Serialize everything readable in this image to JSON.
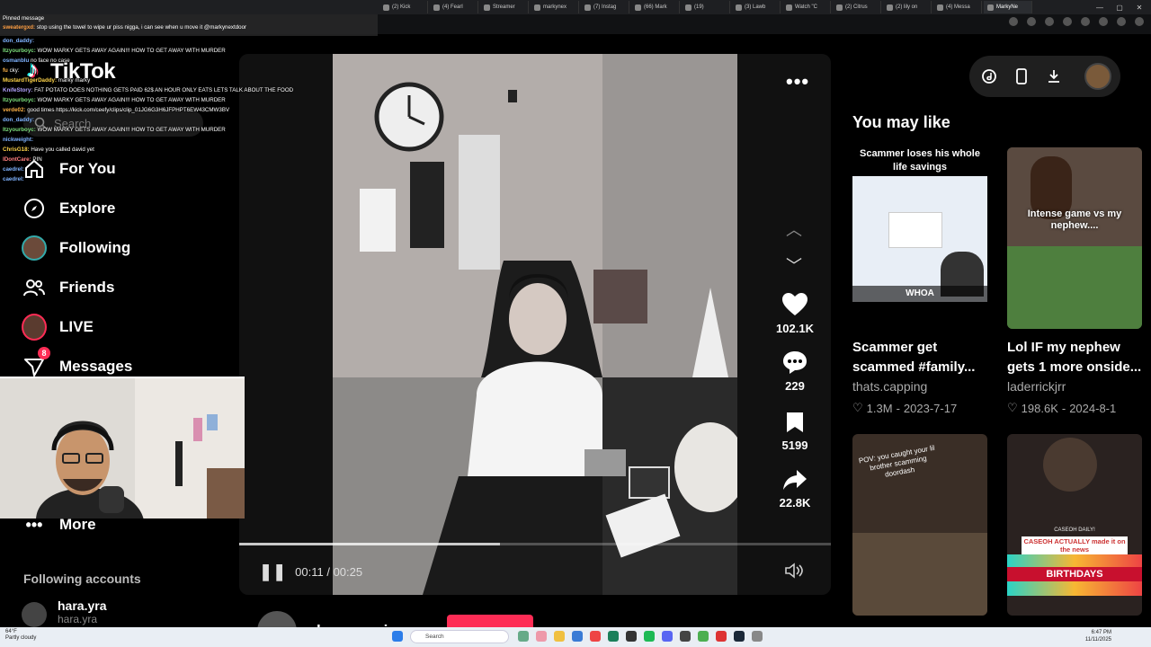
{
  "browser": {
    "tabs": [
      "(2) Kick",
      "(4) Fearl",
      "Streamer",
      "markynex",
      "(7) Instag",
      "(66) Mark",
      "(19)",
      "(3) Lawb",
      "Watch \"C",
      "(2) Citrus",
      "(2) lily on",
      "(4) Messa",
      "MarkyNe"
    ]
  },
  "chat": {
    "pinned_label": "Pinned message",
    "pinned_user": "sweatergxd:",
    "pinned_text": "stop using the towel to wipe ur piss nigga, i can see when u move it @markynextdoor",
    "lines": [
      {
        "user": "don_daddy:",
        "color": "#7fb3ff",
        "text": ""
      },
      {
        "user": "Itzyourboyc:",
        "color": "#7de07d",
        "text": "WOW MARKY GETS AWAY AGAIN!!! HOW TO GET AWAY WITH MURDER"
      },
      {
        "user": "osmanblu",
        "color": "#7fb3ff",
        "text": "no face no case"
      },
      {
        "user": "fu",
        "color": "#ffb347",
        "text": "cky:"
      },
      {
        "user": "MustardTigerDaddy:",
        "color": "#ffd54a",
        "text": "marky marky"
      },
      {
        "user": "KnifeStory:",
        "color": "#b3a3ff",
        "text": "FAT POTATO DOES NOTHING GETS PAID 62$ AN HOUR ONLY EATS LETS TALK ABOUT THE FOOD"
      },
      {
        "user": "Itzyourboyc:",
        "color": "#7de07d",
        "text": "WOW MARKY GETS AWAY AGAIN!!! HOW TO GET AWAY WITH MURDER"
      },
      {
        "user": "verde02:",
        "color": "#ffb347",
        "text": "good times https://kick.com/ceefy/clips/clip_01JG6G3H6JFPHPT6EW43CMW3BV"
      },
      {
        "user": "don_daddy:",
        "color": "#7fb3ff",
        "text": ""
      },
      {
        "user": "Itzyourboyc:",
        "color": "#7de07d",
        "text": "WOW MARKY GETS AWAY AGAIN!!! HOW TO GET AWAY WITH MURDER"
      },
      {
        "user": "nickweight:",
        "color": "#7fb3ff",
        "text": ""
      },
      {
        "user": "ChrisG18:",
        "color": "#ffd54a",
        "text": "Have you called david yet"
      },
      {
        "user": "IDontCare:",
        "color": "#ff7f7f",
        "text": "PIN"
      },
      {
        "user": "caedrel:",
        "color": "#7fb3ff",
        "text": ""
      },
      {
        "user": "caedrel:",
        "color": "#7fb3ff",
        "text": ""
      }
    ]
  },
  "sidebar": {
    "logo": "TikTok",
    "search_placeholder": "Search",
    "items": [
      {
        "label": "For You",
        "icon": "home-icon"
      },
      {
        "label": "Explore",
        "icon": "compass-icon"
      },
      {
        "label": "Following",
        "icon": "following-avatar-icon"
      },
      {
        "label": "Friends",
        "icon": "friends-icon"
      },
      {
        "label": "LIVE",
        "icon": "live-avatar-icon"
      },
      {
        "label": "Messages",
        "icon": "send-icon",
        "badge": "8"
      },
      {
        "label": "More",
        "icon": "more-dots-icon"
      }
    ],
    "following_header": "Following accounts",
    "accounts": [
      {
        "name": "hara.yra",
        "handle": "hara.yra"
      }
    ]
  },
  "video": {
    "time": "00:11 / 00:25",
    "progress": 0.44,
    "author": "bmoneysign",
    "actions": {
      "likes": "102.1K",
      "comments": "229",
      "saves": "5199",
      "shares": "22.8K"
    }
  },
  "you_may_like": {
    "title": "You may like",
    "cards": [
      {
        "overlay": "Scammer loses his whole life savings",
        "thumb_caption": "WHOA",
        "title": "Scammer get scammed #family...",
        "author": "thats.capping",
        "likes": "1.3M",
        "date": "2023-7-17"
      },
      {
        "overlay": "Intense game vs my nephew....",
        "title": "Lol IF my nephew gets 1 more onside...",
        "author": "laderrickjrr",
        "likes": "198.6K",
        "date": "2024-8-1"
      },
      {
        "overlay": "POV: you caught your lil brother scamming doordash"
      },
      {
        "overlay": "CASEOH ACTUALLY made it on the news",
        "banner": "BIRTHDAYS",
        "tag": "CASEOH DAILY!"
      }
    ]
  },
  "taskbar": {
    "weather_temp": "64°F",
    "weather_desc": "Partly cloudy",
    "search_label": "Search",
    "time": "6:47 PM",
    "date": "11/11/2025"
  }
}
